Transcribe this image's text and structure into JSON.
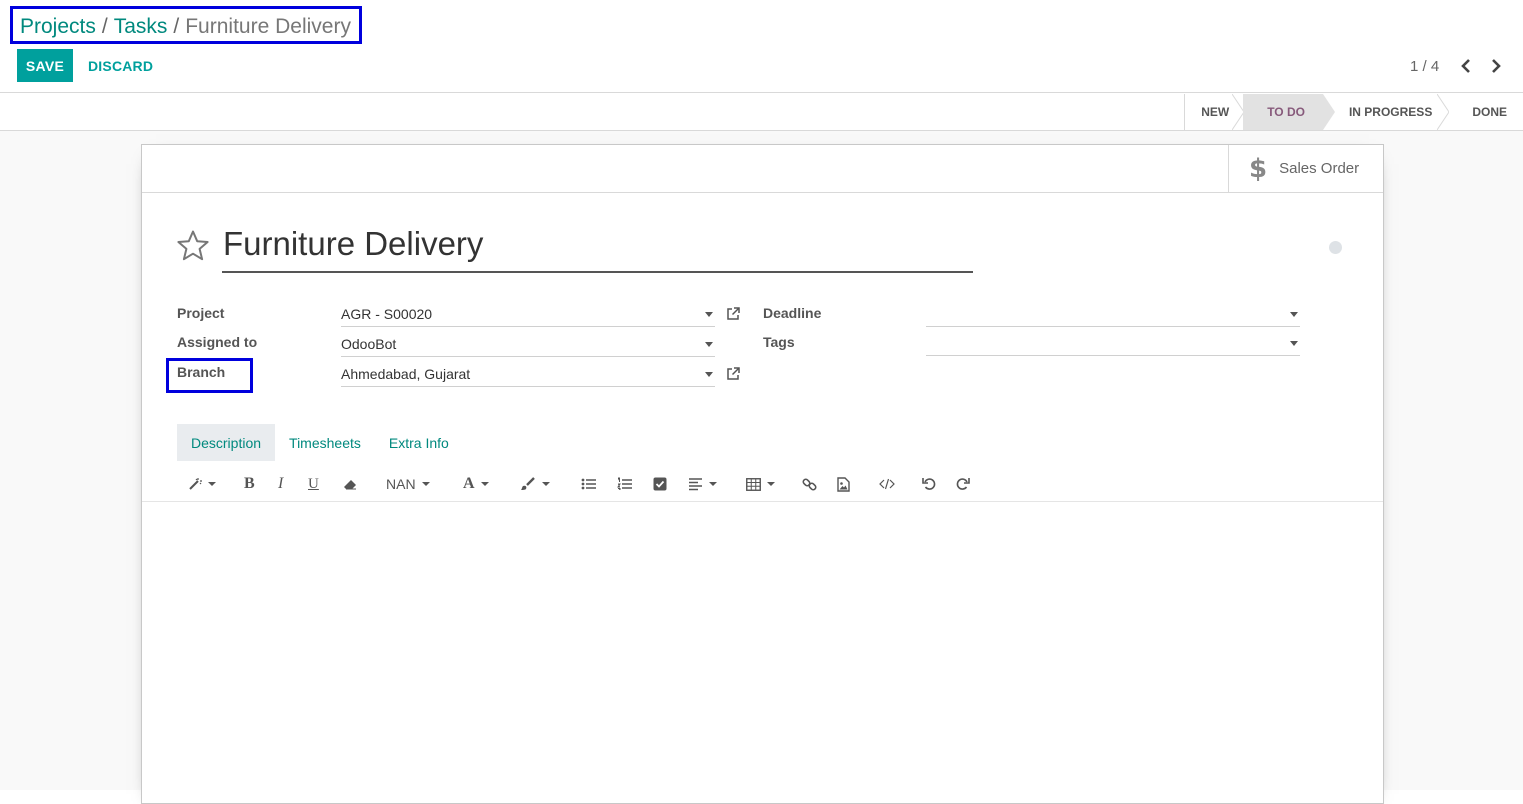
{
  "breadcrumb": {
    "items": [
      "Projects",
      "Tasks"
    ],
    "separator": "/",
    "current": "Furniture Delivery"
  },
  "buttons": {
    "save": "SAVE",
    "discard": "DISCARD"
  },
  "pager": {
    "value": "1 / 4"
  },
  "statusbar": {
    "stages": [
      "NEW",
      "TO DO",
      "IN PROGRESS",
      "DONE"
    ],
    "active": "TO DO"
  },
  "smart_button": {
    "label": "Sales Order",
    "icon": "$"
  },
  "task": {
    "title": "Furniture Delivery"
  },
  "fields": {
    "project": {
      "label": "Project",
      "value": "AGR - S00020"
    },
    "assigned_to": {
      "label": "Assigned to",
      "value": "OdooBot"
    },
    "branch": {
      "label": "Branch",
      "value": "Ahmedabad, Gujarat"
    },
    "deadline": {
      "label": "Deadline",
      "value": ""
    },
    "tags": {
      "label": "Tags",
      "value": ""
    }
  },
  "tabs": [
    "Description",
    "Timesheets",
    "Extra Info"
  ],
  "toolbar": {
    "font_size": "NAN",
    "font_color": "A"
  },
  "colors": {
    "primary": "#00a09d",
    "link": "#00897e",
    "active_stage": "#875a7b",
    "highlight": "#0000dd"
  }
}
